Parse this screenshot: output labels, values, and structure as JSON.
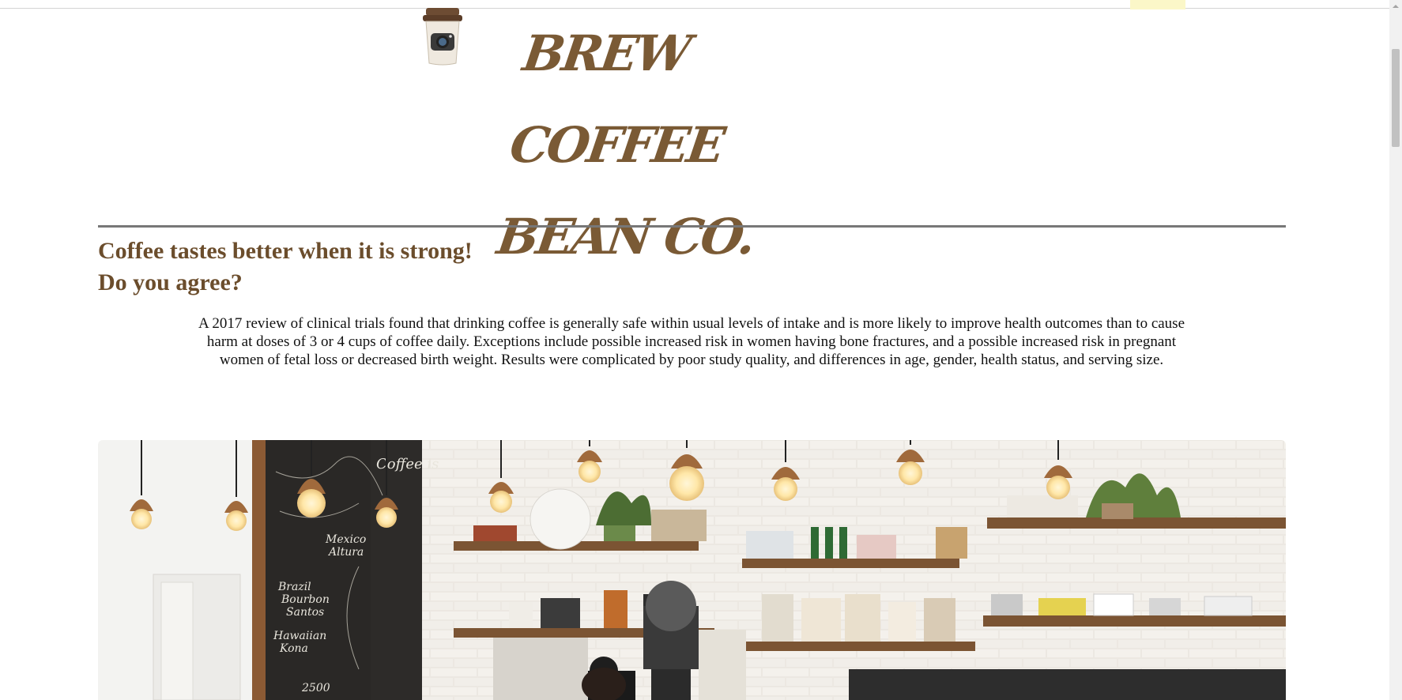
{
  "brand": {
    "line1": "BREW COFFEE",
    "line2": "BEAN CO.",
    "color": "#7a5a35"
  },
  "headline": {
    "line1": "Coffee tastes better when it is strong!",
    "line2": "Do you agree?",
    "color": "#6b4d2c"
  },
  "body_text": "A 2017 review of clinical trials found that drinking coffee is generally safe within usual levels of intake and is more likely to improve health outcomes than to cause harm at doses of 3 or 4 cups of coffee daily. Exceptions include possible increased risk in women having bone fractures, and a possible increased risk in pregnant women of fetal loss or decreased birth weight. Results were complicated by poor study quality, and differences in age, gender, health status, and serving size.",
  "hero_image": {
    "chalkboard_text": [
      "Brazil",
      "Bourbon",
      "Santos",
      "Mexico",
      "Altura",
      "Hawaiian",
      "Kona",
      "2500"
    ],
    "side_board_text": "Coffee is"
  },
  "icons": {
    "logo": "coffee-cup-logo-icon",
    "scroll_up": "scroll-up-arrow-icon"
  }
}
